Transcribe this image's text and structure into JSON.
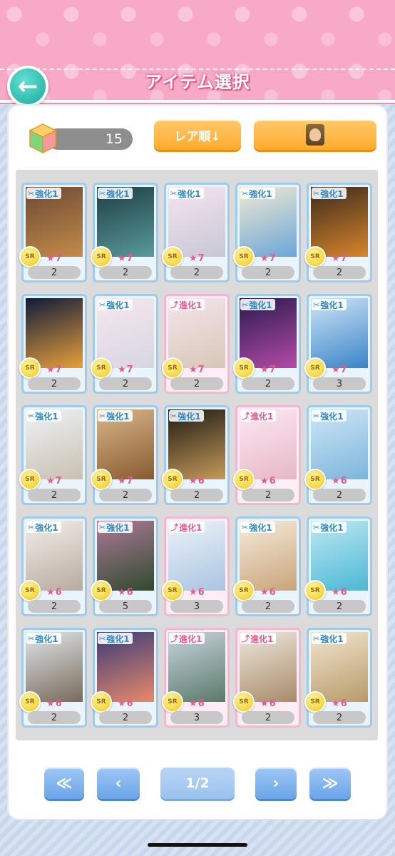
{
  "header": {
    "title": "アイテム選択"
  },
  "back": {
    "icon": "arrow-left-icon"
  },
  "counter": {
    "value": "15",
    "icon": "cube-icon"
  },
  "toolbar": {
    "sort_label": "レア順↓",
    "filter_icon": "character-portrait-icon"
  },
  "items": [
    {
      "badge": "強化1",
      "type": "enhance",
      "rarity": "SR",
      "stars": "7",
      "count": "2"
    },
    {
      "badge": "強化1",
      "type": "enhance",
      "rarity": "SR",
      "stars": "7",
      "count": "2"
    },
    {
      "badge": "強化1",
      "type": "enhance",
      "rarity": "SR",
      "stars": "7",
      "count": "2"
    },
    {
      "badge": "強化1",
      "type": "enhance",
      "rarity": "SR",
      "stars": "7",
      "count": "2"
    },
    {
      "badge": "強化1",
      "type": "enhance",
      "rarity": "SR",
      "stars": "7",
      "count": "2"
    },
    {
      "badge": "",
      "type": "none",
      "rarity": "SR",
      "stars": "7",
      "count": "2"
    },
    {
      "badge": "強化1",
      "type": "enhance",
      "rarity": "SR",
      "stars": "7",
      "count": "2"
    },
    {
      "badge": "進化1",
      "type": "evolve",
      "rarity": "SR",
      "stars": "7",
      "count": "2"
    },
    {
      "badge": "強化1",
      "type": "enhance",
      "rarity": "SR",
      "stars": "7",
      "count": "2"
    },
    {
      "badge": "強化1",
      "type": "enhance",
      "rarity": "SR",
      "stars": "7",
      "count": "3"
    },
    {
      "badge": "強化1",
      "type": "enhance",
      "rarity": "SR",
      "stars": "7",
      "count": "2"
    },
    {
      "badge": "強化1",
      "type": "enhance",
      "rarity": "SR",
      "stars": "7",
      "count": "2"
    },
    {
      "badge": "強化1",
      "type": "enhance",
      "rarity": "SR",
      "stars": "6",
      "count": "2"
    },
    {
      "badge": "進化1",
      "type": "evolve",
      "rarity": "SR",
      "stars": "6",
      "count": "2"
    },
    {
      "badge": "強化1",
      "type": "enhance",
      "rarity": "SR",
      "stars": "6",
      "count": "2"
    },
    {
      "badge": "強化1",
      "type": "enhance",
      "rarity": "SR",
      "stars": "6",
      "count": "2"
    },
    {
      "badge": "強化1",
      "type": "enhance",
      "rarity": "SR",
      "stars": "6",
      "count": "5"
    },
    {
      "badge": "進化1",
      "type": "evolve",
      "rarity": "SR",
      "stars": "6",
      "count": "3"
    },
    {
      "badge": "強化1",
      "type": "enhance",
      "rarity": "SR",
      "stars": "6",
      "count": "2"
    },
    {
      "badge": "強化1",
      "type": "enhance",
      "rarity": "SR",
      "stars": "6",
      "count": "2"
    },
    {
      "badge": "強化1",
      "type": "enhance",
      "rarity": "SR",
      "stars": "6",
      "count": "2"
    },
    {
      "badge": "強化1",
      "type": "enhance",
      "rarity": "SR",
      "stars": "6",
      "count": "2"
    },
    {
      "badge": "進化1",
      "type": "evolve",
      "rarity": "SR",
      "stars": "6",
      "count": "3"
    },
    {
      "badge": "進化1",
      "type": "evolve",
      "rarity": "SR",
      "stars": "6",
      "count": "2"
    },
    {
      "badge": "強化1",
      "type": "enhance",
      "rarity": "SR",
      "stars": "6",
      "count": "2"
    }
  ],
  "pager": {
    "first": "≪",
    "prev": "‹",
    "label": "1/2",
    "next": "›",
    "last": "≫"
  }
}
